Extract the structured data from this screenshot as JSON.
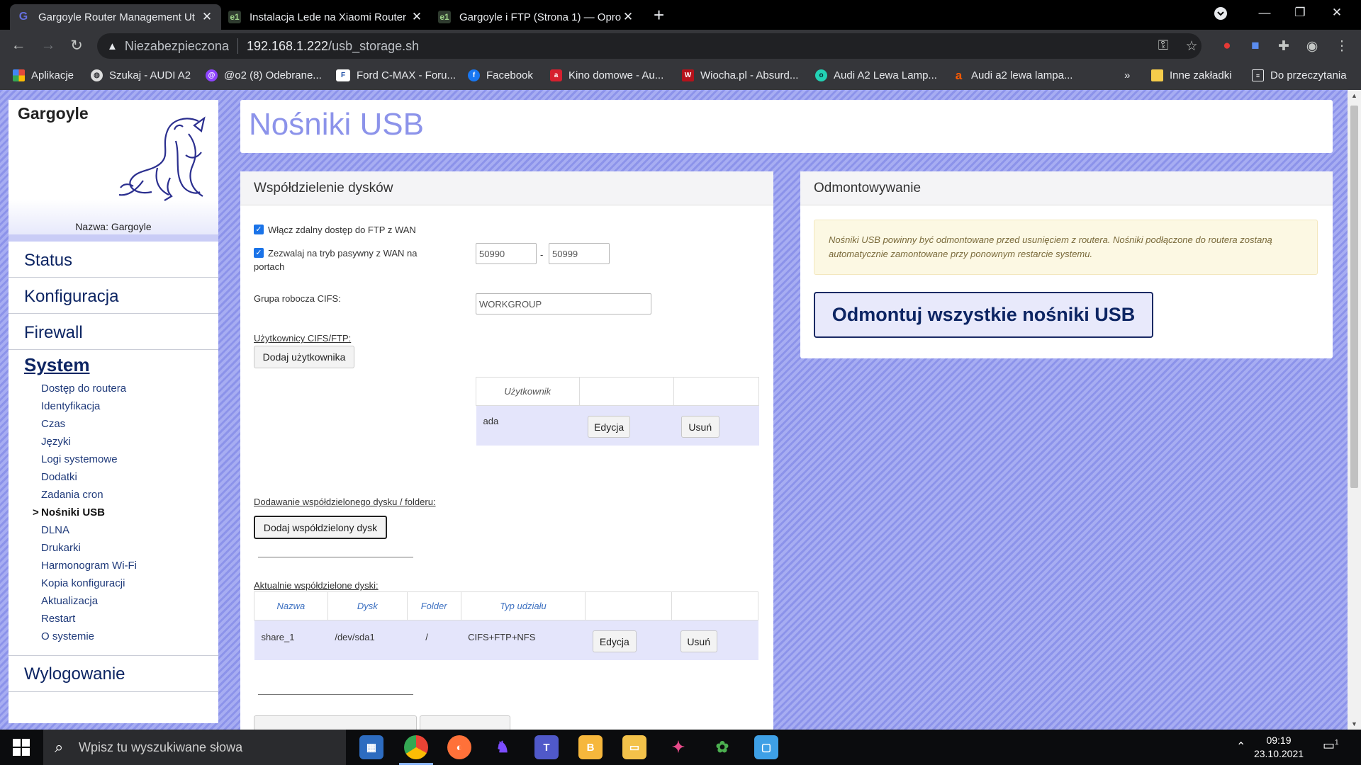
{
  "browser": {
    "tabs": [
      {
        "title": "Gargoyle Router Management Ut",
        "favicon": "G",
        "active": true
      },
      {
        "title": "Instalacja Lede na Xiaomi Router",
        "favicon": "e1",
        "active": false
      },
      {
        "title": "Gargoyle i FTP (Strona 1) — Opro",
        "favicon": "e1",
        "active": false
      }
    ],
    "address": {
      "security_label": "Niezabezpieczona",
      "host": "192.168.1.222",
      "path": "/usb_storage.sh"
    },
    "bookmarks": [
      {
        "label": "Aplikacje",
        "icon": "apps-grid-icon",
        "color": "#e34a3b"
      },
      {
        "label": "Szukaj - AUDI A2",
        "icon": "globe-icon",
        "color": "#dddddd"
      },
      {
        "label": "@o2 (8) Odebrane...",
        "icon": "o2-mail-icon",
        "color": "#8e44ff"
      },
      {
        "label": "Ford C-MAX - Foru...",
        "icon": "ford-icon",
        "color": "#1d4ea5"
      },
      {
        "label": "Facebook",
        "icon": "facebook-icon",
        "color": "#1877f2"
      },
      {
        "label": "Kino domowe - Au...",
        "icon": "audio-icon",
        "color": "#d6202f"
      },
      {
        "label": "Wiocha.pl - Absurd...",
        "icon": "wiocha-icon",
        "color": "#b5121b"
      },
      {
        "label": "Audi A2 Lewa Lamp...",
        "icon": "olx-icon",
        "color": "#23d1b4"
      },
      {
        "label": "Audi a2 lewa lampa...",
        "icon": "allegro-icon",
        "color": "#ff5a00"
      }
    ],
    "more_bookmarks": "»",
    "other_bookmarks": "Inne zakładki",
    "reading_list": "Do przeczytania"
  },
  "sidebar": {
    "router_name": "Gargoyle",
    "device_label": "Nazwa: Gargoyle",
    "main_items": [
      "Status",
      "Konfiguracja",
      "Firewall"
    ],
    "section": "System",
    "sub_items": [
      "Dostęp do routera",
      "Identyfikacja",
      "Czas",
      "Języki",
      "Logi systemowe",
      "Dodatki",
      "Zadania cron",
      "Nośniki USB",
      "DLNA",
      "Drukarki",
      "Harmonogram Wi-Fi",
      "Kopia konfiguracji",
      "Aktualizacja",
      "Restart",
      "O systemie"
    ],
    "current_sub_item": "Nośniki USB",
    "logout": "Wylogowanie"
  },
  "page": {
    "title": "Nośniki USB"
  },
  "share_panel": {
    "title": "Współdzielenie dysków",
    "ftp_wan_label": "Włącz zdalny dostęp do FTP z WAN",
    "ftp_wan_checked": true,
    "passive_label_1": "Zezwalaj na tryb pasywny z WAN na",
    "passive_label_2": "portach",
    "passive_checked": true,
    "port_from": "50990",
    "port_dash": "-",
    "port_to": "50999",
    "cifs_group_label": "Grupa robocza CIFS:",
    "cifs_group_value": "WORKGROUP",
    "users_label": "Użytkownicy CIFS/FTP:",
    "add_user_button": "Dodaj użytkownika",
    "users_table": {
      "header": "Użytkownik",
      "rows": [
        {
          "name": "ada",
          "edit": "Edycja",
          "delete": "Usuń"
        }
      ]
    },
    "add_share_label": "Dodawanie współdzielonego dysku / folderu:",
    "add_share_button": "Dodaj współdzielony dysk",
    "current_shares_label": "Aktualnie współdzielone dyski:",
    "shares_table": {
      "headers": [
        "Nazwa",
        "Dysk",
        "Folder",
        "Typ udziału"
      ],
      "rows": [
        {
          "name": "share_1",
          "disk": "/dev/sda1",
          "folder": "/",
          "type": "CIFS+FTP+NFS",
          "edit": "Edycja",
          "delete": "Usuń"
        }
      ]
    }
  },
  "unmount_panel": {
    "title": "Odmontowywanie",
    "notice_1": "Nośniki USB powinny być odmontowane przed usunięciem z routera. Nośniki podłączone do routera zostaną",
    "notice_2": "automatycznie zamontowane przy ponownym restarcie systemu.",
    "button": "Odmontuj wszystkie nośniki USB"
  },
  "taskbar": {
    "search_placeholder": "Wpisz tu wyszukiwane słowa",
    "time": "09:19",
    "date": "23.10.2021",
    "notifications": "1"
  },
  "colors": {
    "accent": "#8c93ea",
    "nav_text": "#0d2563",
    "notice_bg": "#fcf8e3",
    "table_row": "#e4e5fb"
  }
}
